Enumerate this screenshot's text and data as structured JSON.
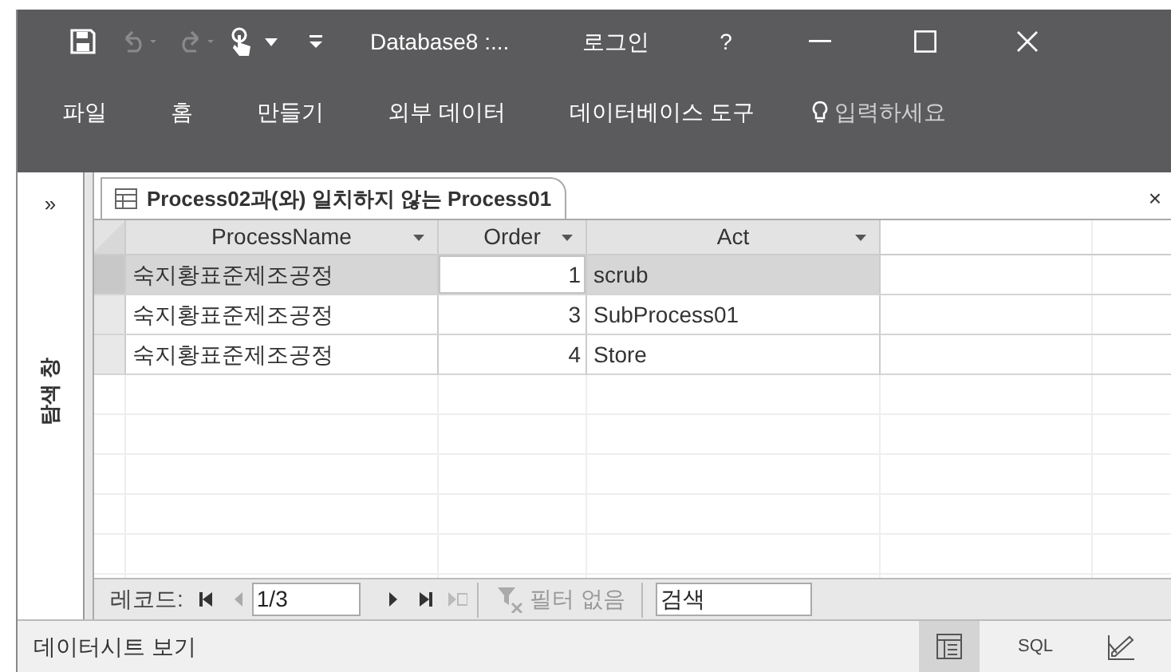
{
  "title_bar": {
    "title": "Database8 :...",
    "sign_in": "로그인",
    "help": "?"
  },
  "ribbon_tabs": [
    {
      "label": "파일"
    },
    {
      "label": "홈"
    },
    {
      "label": "만들기"
    },
    {
      "label": "외부 데이터"
    },
    {
      "label": "데이터베이스 도구"
    }
  ],
  "tell_me": {
    "placeholder": "입력하세요"
  },
  "nav_pane": {
    "toggle": "»",
    "label": "탐색 창"
  },
  "document_tab": {
    "title": "Process02과(와) 일치하지 않는 Process01",
    "close": "×"
  },
  "table": {
    "columns": [
      {
        "label": "ProcessName",
        "kind": "text"
      },
      {
        "label": "Order",
        "kind": "number"
      },
      {
        "label": "Act",
        "kind": "text"
      }
    ],
    "rows": [
      {
        "selected": true,
        "cells": [
          {
            "text": "숙지황표준제조공정",
            "current": false
          },
          {
            "text": "1",
            "current": true
          },
          {
            "text": "scrub",
            "current": false
          }
        ]
      },
      {
        "selected": false,
        "cells": [
          {
            "text": "숙지황표준제조공정",
            "current": false
          },
          {
            "text": "3",
            "current": false
          },
          {
            "text": "SubProcess01",
            "current": false
          }
        ]
      },
      {
        "selected": false,
        "cells": [
          {
            "text": "숙지황표준제조공정",
            "current": false
          },
          {
            "text": "4",
            "current": false
          },
          {
            "text": "Store",
            "current": false
          }
        ]
      }
    ]
  },
  "record_nav": {
    "label": "레코드:",
    "position": "1/3",
    "filter": "필터 없음",
    "search": {
      "placeholder": "검색"
    }
  },
  "status_bar": {
    "text": "데이터시트 보기",
    "views": [
      {
        "kind": "datasheet",
        "selected": true
      },
      {
        "kind": "sql",
        "label": "SQL",
        "selected": false
      },
      {
        "kind": "design",
        "selected": false
      }
    ]
  }
}
